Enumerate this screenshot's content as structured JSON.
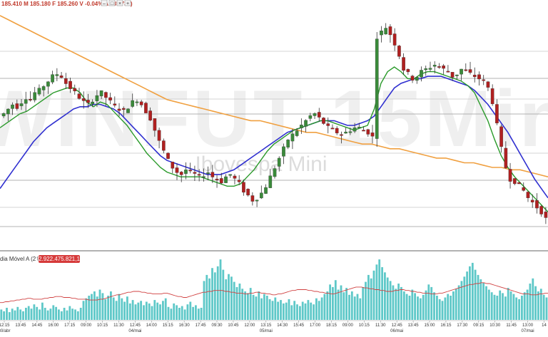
{
  "header": {
    "ohlc_text": "185.410 M 185.180 F 185.260 V -0.04% A 185.735)",
    "buttons": [
      "–",
      "□",
      "×",
      "+"
    ]
  },
  "watermark": {
    "symbol": "WINFUT 15Min",
    "name": "Ibovespa Mini"
  },
  "volume_panel": {
    "label": "dia Móvel A (21)",
    "value_badge": "12.922.475.821,10",
    "badge_color": "#d63a3a"
  },
  "colors": {
    "up_candle": "#3a8a3a",
    "down_candle": "#b02020",
    "ma_fast": "#2a9a2a",
    "ma_slow": "#3030d0",
    "ma_long": "#f0a040",
    "volume_bar": "#5ec8c8",
    "volume_ma": "#d04040"
  },
  "chart_data": {
    "type": "candlestick",
    "x_tick_labels": [
      {
        "time": "12:15",
        "date": "30/abr"
      },
      {
        "time": "13:45",
        "date": ""
      },
      {
        "time": "14:45",
        "date": ""
      },
      {
        "time": "16:00",
        "date": ""
      },
      {
        "time": "17:15",
        "date": ""
      },
      {
        "time": "09:00",
        "date": ""
      },
      {
        "time": "10:15",
        "date": ""
      },
      {
        "time": "11:30",
        "date": ""
      },
      {
        "time": "12:45",
        "date": "04/mai"
      },
      {
        "time": "14:00",
        "date": ""
      },
      {
        "time": "15:15",
        "date": ""
      },
      {
        "time": "16:30",
        "date": ""
      },
      {
        "time": "17:45",
        "date": ""
      },
      {
        "time": "09:30",
        "date": ""
      },
      {
        "time": "10:45",
        "date": ""
      },
      {
        "time": "12:00",
        "date": ""
      },
      {
        "time": "13:15",
        "date": "05/mai"
      },
      {
        "time": "14:30",
        "date": ""
      },
      {
        "time": "15:45",
        "date": ""
      },
      {
        "time": "17:00",
        "date": ""
      },
      {
        "time": "18:15",
        "date": ""
      },
      {
        "time": "09:00",
        "date": ""
      },
      {
        "time": "10:15",
        "date": ""
      },
      {
        "time": "11:30",
        "date": ""
      },
      {
        "time": "12:45",
        "date": "06/mai"
      },
      {
        "time": "13:45",
        "date": ""
      },
      {
        "time": "15:00",
        "date": ""
      },
      {
        "time": "16:15",
        "date": ""
      },
      {
        "time": "17:30",
        "date": ""
      },
      {
        "time": "09:15",
        "date": ""
      },
      {
        "time": "10:30",
        "date": ""
      },
      {
        "time": "11:45",
        "date": ""
      },
      {
        "time": "13:00",
        "date": "07/mai"
      },
      {
        "time": "14",
        "date": ""
      }
    ],
    "price_path": [
      115,
      117,
      119,
      118,
      120,
      122,
      121,
      124,
      125,
      127,
      129,
      131,
      132,
      131,
      128,
      126,
      124,
      122,
      120,
      119,
      121,
      123,
      124,
      122,
      120,
      118,
      117,
      116,
      118,
      120,
      121,
      119,
      116,
      113,
      108,
      103,
      99,
      95,
      92,
      90,
      89,
      91,
      90,
      89,
      88,
      89,
      90,
      88,
      87,
      86,
      88,
      89,
      87,
      85,
      82,
      80,
      78,
      79,
      81,
      84,
      88,
      92,
      96,
      100,
      104,
      106,
      108,
      110,
      112,
      114,
      115,
      113,
      111,
      109,
      108,
      107,
      106,
      107,
      108,
      109,
      109,
      108,
      107,
      105,
      148,
      150,
      152,
      149,
      145,
      140,
      134,
      132,
      130,
      131,
      133,
      134,
      135,
      136,
      135,
      134,
      133,
      131,
      132,
      134,
      133,
      132,
      131,
      130,
      129,
      126,
      120,
      110,
      100,
      92,
      87,
      86,
      84,
      82,
      79,
      77,
      75,
      73,
      70
    ],
    "ma_fast": [
      109,
      111,
      113,
      115,
      116,
      118,
      120,
      122,
      124,
      125,
      126,
      126,
      124,
      120,
      118,
      120,
      119,
      116,
      113,
      110,
      106,
      102,
      98,
      95,
      92,
      90,
      89,
      88,
      88,
      88,
      88,
      87,
      86,
      85,
      84,
      84,
      85,
      88,
      91,
      95,
      99,
      102,
      104,
      106,
      108,
      109,
      110,
      111,
      112,
      112,
      111,
      110,
      109,
      108,
      109,
      110,
      117,
      128,
      133,
      135,
      133,
      130,
      130,
      132,
      133,
      133,
      132,
      131,
      130,
      129,
      127,
      124,
      118,
      112,
      104,
      97,
      92,
      88,
      85,
      82,
      79,
      76,
      73
    ],
    "ma_slow": [
      83,
      87,
      91,
      95,
      99,
      103,
      106,
      109,
      111,
      113,
      115,
      117,
      118,
      118,
      119,
      119,
      118,
      117,
      115,
      112,
      109,
      106,
      103,
      100,
      97,
      95,
      94,
      93,
      92,
      91,
      90,
      89,
      89,
      89,
      90,
      91,
      93,
      95,
      97,
      99,
      101,
      103,
      105,
      107,
      108,
      109,
      110,
      111,
      112,
      112,
      112,
      111,
      110,
      110,
      111,
      112,
      114,
      118,
      122,
      126,
      128,
      129,
      130,
      130,
      131,
      131,
      131,
      130,
      129,
      128,
      127,
      125,
      122,
      119,
      115,
      111,
      107,
      102,
      97,
      92,
      87,
      83,
      79
    ],
    "ma_long": [
      157,
      155,
      153,
      151,
      149,
      147,
      145,
      143,
      141,
      139,
      137,
      135,
      133,
      131,
      129,
      127,
      125,
      123,
      121,
      120,
      119,
      118,
      117,
      116,
      115,
      114,
      113,
      112,
      112,
      111,
      110,
      109,
      108,
      107,
      107,
      106,
      105,
      104,
      103,
      102,
      102,
      101,
      100,
      100,
      99,
      98,
      97,
      96,
      96,
      95,
      94,
      94,
      93,
      92,
      92,
      91,
      91,
      90,
      89,
      88
    ],
    "volume": [
      12,
      10,
      14,
      9,
      13,
      11,
      15,
      12,
      10,
      14,
      16,
      13,
      18,
      15,
      12,
      20,
      14,
      11,
      13,
      17,
      15,
      12,
      10,
      14,
      11,
      16,
      13,
      12,
      10,
      14,
      22,
      25,
      28,
      30,
      33,
      27,
      35,
      31,
      24,
      28,
      33,
      26,
      22,
      30,
      25,
      21,
      27,
      19,
      23,
      18,
      20,
      22,
      17,
      21,
      19,
      16,
      23,
      20,
      18,
      22,
      25,
      15,
      13,
      19,
      17,
      14,
      16,
      12,
      18,
      21,
      15,
      17,
      13,
      14,
      45,
      52,
      48,
      60,
      55,
      62,
      70,
      58,
      47,
      53,
      50,
      44,
      38,
      42,
      36,
      33,
      31,
      37,
      29,
      27,
      33,
      25,
      30,
      28,
      24,
      22,
      26,
      21,
      23,
      19,
      20,
      24,
      17,
      22,
      18,
      16,
      21,
      19,
      23,
      20,
      18,
      25,
      22,
      26,
      30,
      33,
      41,
      38,
      46,
      35,
      40,
      32,
      37,
      29,
      33,
      27,
      30,
      25,
      38,
      44,
      52,
      48,
      57,
      64,
      70,
      61,
      55,
      49,
      45,
      40,
      36,
      42,
      38,
      33,
      30,
      28,
      35,
      31,
      27,
      25,
      29,
      34,
      41,
      38,
      32,
      28,
      24,
      22,
      26,
      30,
      28,
      33,
      36,
      40,
      45,
      50,
      56,
      62,
      66,
      58,
      52,
      47,
      43,
      39,
      35,
      32,
      29,
      28,
      34,
      31,
      27,
      37,
      33,
      30,
      26,
      24,
      28,
      32,
      35,
      42,
      48,
      39,
      33,
      36,
      29,
      26
    ],
    "volume_ma": [
      20,
      20,
      21,
      21,
      22,
      22,
      23,
      23,
      24,
      24,
      25,
      25,
      24,
      24,
      24,
      24,
      25,
      25,
      26,
      26,
      27,
      27,
      27,
      26,
      26,
      26,
      25,
      25,
      24,
      24,
      24,
      24,
      23,
      23,
      23,
      23,
      24,
      24,
      25,
      26,
      27,
      28,
      29,
      29,
      30,
      31,
      32,
      32,
      33,
      33,
      33,
      32,
      32,
      31,
      31,
      30,
      30,
      30,
      30,
      31,
      31,
      30,
      29,
      28,
      27,
      27,
      26,
      26,
      27,
      28,
      29,
      30,
      31,
      32,
      32,
      33,
      33,
      34,
      34,
      34,
      34,
      33,
      33,
      32,
      32,
      31,
      31,
      31,
      30,
      30,
      31,
      31,
      32,
      32,
      31,
      31,
      30,
      30,
      29,
      29,
      30,
      30,
      31,
      32,
      33,
      34,
      34,
      35,
      35,
      35,
      35,
      34,
      34,
      33,
      33,
      32,
      32,
      31,
      31,
      30,
      30,
      31,
      32,
      33,
      34,
      35,
      36,
      37,
      38,
      38,
      38,
      37,
      37,
      36,
      36,
      35,
      35,
      34,
      34,
      33,
      33,
      33,
      34,
      34,
      35,
      35,
      34,
      34,
      33,
      33,
      32,
      32,
      31,
      31,
      31,
      30,
      30,
      30,
      31,
      31,
      32,
      33,
      34,
      35,
      36,
      37,
      38,
      39,
      40,
      41,
      41,
      42,
      42,
      43,
      43,
      42,
      42,
      41,
      40,
      39,
      38,
      37,
      36,
      35,
      34,
      33,
      32,
      31,
      30,
      30,
      30,
      29,
      29,
      29,
      30,
      30,
      31,
      31
    ]
  }
}
